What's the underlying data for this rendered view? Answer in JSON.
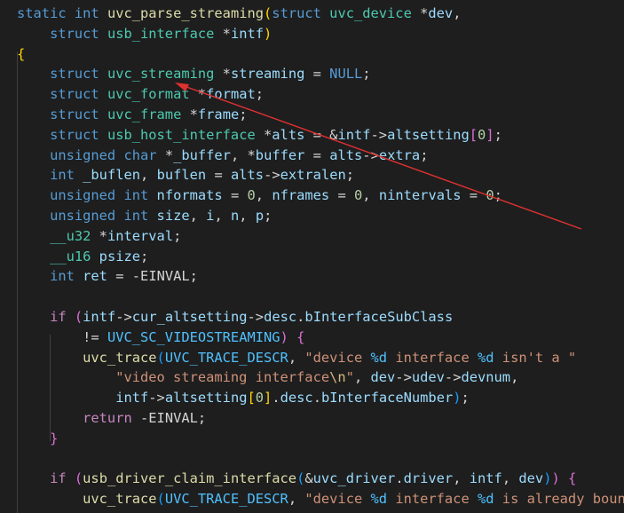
{
  "annotation": {
    "arrow_color": "#e03131"
  },
  "code_lines": [
    [
      {
        "t": "static ",
        "c": "kw"
      },
      {
        "t": "int ",
        "c": "kw"
      },
      {
        "t": "uvc_parse_streaming",
        "c": "fn"
      },
      {
        "t": "(",
        "c": "p1"
      },
      {
        "t": "struct ",
        "c": "kw"
      },
      {
        "t": "uvc_device ",
        "c": "ty"
      },
      {
        "t": "*",
        "c": "plain"
      },
      {
        "t": "dev",
        "c": "var"
      },
      {
        "t": ",",
        "c": "plain"
      }
    ],
    [
      {
        "t": "    struct ",
        "c": "kw"
      },
      {
        "t": "usb_interface ",
        "c": "ty"
      },
      {
        "t": "*",
        "c": "plain"
      },
      {
        "t": "intf",
        "c": "var"
      },
      {
        "t": ")",
        "c": "p1"
      }
    ],
    [
      {
        "t": "{",
        "c": "p1"
      }
    ],
    [
      {
        "t": "    struct ",
        "c": "kw"
      },
      {
        "t": "uvc_streaming ",
        "c": "ty"
      },
      {
        "t": "*",
        "c": "plain"
      },
      {
        "t": "streaming",
        "c": "var"
      },
      {
        "t": " = ",
        "c": "plain"
      },
      {
        "t": "NULL",
        "c": "kw"
      },
      {
        "t": ";",
        "c": "plain"
      }
    ],
    [
      {
        "t": "    struct ",
        "c": "kw"
      },
      {
        "t": "uvc_format ",
        "c": "ty"
      },
      {
        "t": "*",
        "c": "plain"
      },
      {
        "t": "format",
        "c": "var"
      },
      {
        "t": ";",
        "c": "plain"
      }
    ],
    [
      {
        "t": "    struct ",
        "c": "kw"
      },
      {
        "t": "uvc_frame ",
        "c": "ty"
      },
      {
        "t": "*",
        "c": "plain"
      },
      {
        "t": "frame",
        "c": "var"
      },
      {
        "t": ";",
        "c": "plain"
      }
    ],
    [
      {
        "t": "    struct ",
        "c": "kw"
      },
      {
        "t": "usb_host_interface ",
        "c": "ty"
      },
      {
        "t": "*",
        "c": "plain"
      },
      {
        "t": "alts",
        "c": "var"
      },
      {
        "t": " = ",
        "c": "plain"
      },
      {
        "t": "&",
        "c": "plain"
      },
      {
        "t": "intf",
        "c": "var"
      },
      {
        "t": "->",
        "c": "plain"
      },
      {
        "t": "altsetting",
        "c": "var"
      },
      {
        "t": "[",
        "c": "p2"
      },
      {
        "t": "0",
        "c": "num"
      },
      {
        "t": "]",
        "c": "p2"
      },
      {
        "t": ";",
        "c": "plain"
      }
    ],
    [
      {
        "t": "    unsigned ",
        "c": "kw"
      },
      {
        "t": "char ",
        "c": "kw"
      },
      {
        "t": "*",
        "c": "plain"
      },
      {
        "t": "_buffer",
        "c": "var"
      },
      {
        "t": ", ",
        "c": "plain"
      },
      {
        "t": "*",
        "c": "plain"
      },
      {
        "t": "buffer",
        "c": "var"
      },
      {
        "t": " = ",
        "c": "plain"
      },
      {
        "t": "alts",
        "c": "var"
      },
      {
        "t": "->",
        "c": "plain"
      },
      {
        "t": "extra",
        "c": "var"
      },
      {
        "t": ";",
        "c": "plain"
      }
    ],
    [
      {
        "t": "    int ",
        "c": "kw"
      },
      {
        "t": "_buflen",
        "c": "var"
      },
      {
        "t": ", ",
        "c": "plain"
      },
      {
        "t": "buflen",
        "c": "var"
      },
      {
        "t": " = ",
        "c": "plain"
      },
      {
        "t": "alts",
        "c": "var"
      },
      {
        "t": "->",
        "c": "plain"
      },
      {
        "t": "extralen",
        "c": "var"
      },
      {
        "t": ";",
        "c": "plain"
      }
    ],
    [
      {
        "t": "    unsigned ",
        "c": "kw"
      },
      {
        "t": "int ",
        "c": "kw"
      },
      {
        "t": "nformats",
        "c": "var"
      },
      {
        "t": " = ",
        "c": "plain"
      },
      {
        "t": "0",
        "c": "num"
      },
      {
        "t": ", ",
        "c": "plain"
      },
      {
        "t": "nframes",
        "c": "var"
      },
      {
        "t": " = ",
        "c": "plain"
      },
      {
        "t": "0",
        "c": "num"
      },
      {
        "t": ", ",
        "c": "plain"
      },
      {
        "t": "nintervals",
        "c": "var"
      },
      {
        "t": " = ",
        "c": "plain"
      },
      {
        "t": "0",
        "c": "num"
      },
      {
        "t": ";",
        "c": "plain"
      }
    ],
    [
      {
        "t": "    unsigned ",
        "c": "kw"
      },
      {
        "t": "int ",
        "c": "kw"
      },
      {
        "t": "size",
        "c": "var"
      },
      {
        "t": ", ",
        "c": "plain"
      },
      {
        "t": "i",
        "c": "var"
      },
      {
        "t": ", ",
        "c": "plain"
      },
      {
        "t": "n",
        "c": "var"
      },
      {
        "t": ", ",
        "c": "plain"
      },
      {
        "t": "p",
        "c": "var"
      },
      {
        "t": ";",
        "c": "plain"
      }
    ],
    [
      {
        "t": "    __u32 ",
        "c": "ty"
      },
      {
        "t": "*",
        "c": "plain"
      },
      {
        "t": "interval",
        "c": "var"
      },
      {
        "t": ";",
        "c": "plain"
      }
    ],
    [
      {
        "t": "    __u16 ",
        "c": "ty"
      },
      {
        "t": "psize",
        "c": "var"
      },
      {
        "t": ";",
        "c": "plain"
      }
    ],
    [
      {
        "t": "    int ",
        "c": "kw"
      },
      {
        "t": "ret",
        "c": "var"
      },
      {
        "t": " = ",
        "c": "plain"
      },
      {
        "t": "-",
        "c": "plain"
      },
      {
        "t": "EINVAL",
        "c": "plain"
      },
      {
        "t": ";",
        "c": "plain"
      }
    ],
    [],
    [
      {
        "t": "    if ",
        "c": "ctl"
      },
      {
        "t": "(",
        "c": "p2"
      },
      {
        "t": "intf",
        "c": "var"
      },
      {
        "t": "->",
        "c": "plain"
      },
      {
        "t": "cur_altsetting",
        "c": "var"
      },
      {
        "t": "->",
        "c": "plain"
      },
      {
        "t": "desc",
        "c": "var"
      },
      {
        "t": ".",
        "c": "plain"
      },
      {
        "t": "bInterfaceSubClass",
        "c": "var"
      }
    ],
    [
      {
        "t": "        != ",
        "c": "plain"
      },
      {
        "t": "UVC_SC_VIDEOSTREAMING",
        "c": "mac"
      },
      {
        "t": ")",
        "c": "p2"
      },
      {
        "t": " {",
        "c": "p2"
      }
    ],
    [
      {
        "t": "        uvc_trace",
        "c": "fn"
      },
      {
        "t": "(",
        "c": "p3"
      },
      {
        "t": "UVC_TRACE_DESCR",
        "c": "mac"
      },
      {
        "t": ", ",
        "c": "plain"
      },
      {
        "t": "\"device ",
        "c": "str"
      },
      {
        "t": "%d",
        "c": "mac"
      },
      {
        "t": " interface ",
        "c": "str"
      },
      {
        "t": "%d",
        "c": "mac"
      },
      {
        "t": " isn't a \"",
        "c": "str"
      }
    ],
    [
      {
        "t": "            \"video streaming interface",
        "c": "str"
      },
      {
        "t": "\\n",
        "c": "esc"
      },
      {
        "t": "\"",
        "c": "str"
      },
      {
        "t": ", ",
        "c": "plain"
      },
      {
        "t": "dev",
        "c": "var"
      },
      {
        "t": "->",
        "c": "plain"
      },
      {
        "t": "udev",
        "c": "var"
      },
      {
        "t": "->",
        "c": "plain"
      },
      {
        "t": "devnum",
        "c": "var"
      },
      {
        "t": ",",
        "c": "plain"
      }
    ],
    [
      {
        "t": "            intf",
        "c": "var"
      },
      {
        "t": "->",
        "c": "plain"
      },
      {
        "t": "altsetting",
        "c": "var"
      },
      {
        "t": "[",
        "c": "p1"
      },
      {
        "t": "0",
        "c": "num"
      },
      {
        "t": "]",
        "c": "p1"
      },
      {
        "t": ".",
        "c": "plain"
      },
      {
        "t": "desc",
        "c": "var"
      },
      {
        "t": ".",
        "c": "plain"
      },
      {
        "t": "bInterfaceNumber",
        "c": "var"
      },
      {
        "t": ")",
        "c": "p3"
      },
      {
        "t": ";",
        "c": "plain"
      }
    ],
    [
      {
        "t": "        return ",
        "c": "ctl"
      },
      {
        "t": "-",
        "c": "plain"
      },
      {
        "t": "EINVAL",
        "c": "plain"
      },
      {
        "t": ";",
        "c": "plain"
      }
    ],
    [
      {
        "t": "    }",
        "c": "p2"
      }
    ],
    [],
    [
      {
        "t": "    if ",
        "c": "ctl"
      },
      {
        "t": "(",
        "c": "p2"
      },
      {
        "t": "usb_driver_claim_interface",
        "c": "fn"
      },
      {
        "t": "(",
        "c": "p3"
      },
      {
        "t": "&",
        "c": "plain"
      },
      {
        "t": "uvc_driver",
        "c": "var"
      },
      {
        "t": ".",
        "c": "plain"
      },
      {
        "t": "driver",
        "c": "var"
      },
      {
        "t": ", ",
        "c": "plain"
      },
      {
        "t": "intf",
        "c": "var"
      },
      {
        "t": ", ",
        "c": "plain"
      },
      {
        "t": "dev",
        "c": "var"
      },
      {
        "t": ")",
        "c": "p3"
      },
      {
        "t": ")",
        "c": "p2"
      },
      {
        "t": " {",
        "c": "p2"
      }
    ],
    [
      {
        "t": "        uvc_trace",
        "c": "fn"
      },
      {
        "t": "(",
        "c": "p3"
      },
      {
        "t": "UVC_TRACE_DESCR",
        "c": "mac"
      },
      {
        "t": ", ",
        "c": "plain"
      },
      {
        "t": "\"device ",
        "c": "str"
      },
      {
        "t": "%d",
        "c": "mac"
      },
      {
        "t": " interface ",
        "c": "str"
      },
      {
        "t": "%d",
        "c": "mac"
      },
      {
        "t": " is already bound \"",
        "c": "str"
      }
    ]
  ]
}
